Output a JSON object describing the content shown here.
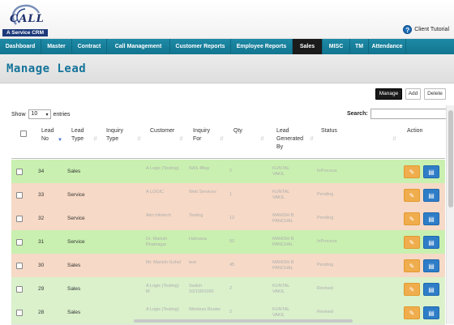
{
  "brand": {
    "logo_text": "CALL",
    "tagline": "A Service CRM"
  },
  "header": {
    "tutorial_label": "Client Tutorial"
  },
  "nav": {
    "items": [
      {
        "label": "Dashboard",
        "active": false
      },
      {
        "label": "Master",
        "active": false
      },
      {
        "label": "Contract",
        "active": false
      },
      {
        "label": "Call Management",
        "active": false
      },
      {
        "label": "Customer Reports",
        "active": false
      },
      {
        "label": "Employee Reports",
        "active": false
      },
      {
        "label": "Sales",
        "active": true
      },
      {
        "label": "MISC",
        "active": false
      },
      {
        "label": "TM",
        "active": false
      },
      {
        "label": "Attendance",
        "active": false
      }
    ]
  },
  "page": {
    "title": "Manage Lead"
  },
  "toolbar": {
    "manage_label": "Manage",
    "add_label": "Add",
    "delete_label": "Delete"
  },
  "table_controls": {
    "show_label": "Show",
    "page_size": "10",
    "entries_label": "entries",
    "search_label": "Search:",
    "search_value": ""
  },
  "table": {
    "columns": [
      "Lead No",
      "Lead Type",
      "Inquiry Type",
      "Customer",
      "Inquiry For",
      "Qty",
      "Lead Generated By",
      "Status",
      "Action"
    ],
    "rows": [
      {
        "no": "34",
        "type": "Sales",
        "inquiry_type": "",
        "customer": "A Logix (Testing)",
        "inquiry_for": "NAS 4Bay",
        "qty": "2",
        "generated_by": "KUNTAL VAKIL",
        "status": "InProcess",
        "bg": "#c9f0b0"
      },
      {
        "no": "33",
        "type": "Service",
        "inquiry_type": "",
        "customer": "A LOGIC",
        "inquiry_for": "Web Services",
        "qty": "1",
        "generated_by": "KUNTAL VAKIL",
        "status": "Pending",
        "bg": "#f6d9c6"
      },
      {
        "no": "32",
        "type": "Service",
        "inquiry_type": "",
        "customer": "Atm Infotech",
        "inquiry_for": "Testing",
        "qty": "12",
        "generated_by": "MANISH B PANCHAL",
        "status": "Pending",
        "bg": "#f6d9c6"
      },
      {
        "no": "31",
        "type": "Service",
        "inquiry_type": "",
        "customer": "Dr. Manish Bhatnagar",
        "inquiry_for": "Hahsana",
        "qty": "50",
        "generated_by": "MANISH B PANCHAL",
        "status": "InProcess",
        "bg": "#c9f0b0"
      },
      {
        "no": "30",
        "type": "Sales",
        "inquiry_type": "",
        "customer": "Mr. Manish Gohel",
        "inquiry_for": "test",
        "qty": "45",
        "generated_by": "MANISH B PANCHAL",
        "status": "Pending",
        "bg": "#f6d9c6"
      },
      {
        "no": "29",
        "type": "Sales",
        "inquiry_type": "",
        "customer": "A Logix (Testing) M",
        "inquiry_for": "Switch 10/100/1000",
        "qty": "2",
        "generated_by": "KUNTAL VAKIL",
        "status": "Revised",
        "bg": "#daf1cc"
      },
      {
        "no": "28",
        "type": "Sales",
        "inquiry_type": "",
        "customer": "A Logix (Testing)",
        "inquiry_for": "Wireless Router",
        "qty": "2",
        "generated_by": "KUNTAL VAKIL",
        "status": "Revised",
        "bg": "#daf1cc"
      }
    ]
  },
  "colors": {
    "nav_bg": "#1a849f",
    "nav_active": "#1b1b1b",
    "title": "#15749a",
    "edit_btn": "#f0ad4e",
    "view_btn": "#2f7dc7"
  }
}
